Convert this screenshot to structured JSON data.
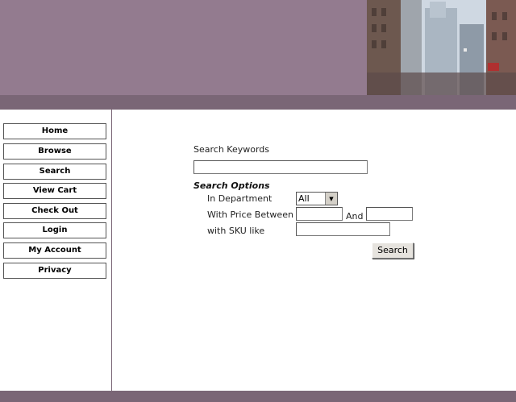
{
  "nav": [
    {
      "label": "Home"
    },
    {
      "label": "Browse"
    },
    {
      "label": "Search"
    },
    {
      "label": "View Cart"
    },
    {
      "label": "Check Out"
    },
    {
      "label": "Login"
    },
    {
      "label": "My Account"
    },
    {
      "label": "Privacy"
    }
  ],
  "search": {
    "keywords_label": "Search Keywords",
    "keywords_value": "",
    "options_heading": "Search Options",
    "department_label": "In Department",
    "department_value": "All",
    "price_label": "With Price Between",
    "price_and_label": "And",
    "price_min_value": "",
    "price_max_value": "",
    "sku_label": "with SKU like",
    "sku_value": "",
    "submit_label": "Search"
  },
  "colors": {
    "header": "#937b8f",
    "band": "#7a6676"
  }
}
